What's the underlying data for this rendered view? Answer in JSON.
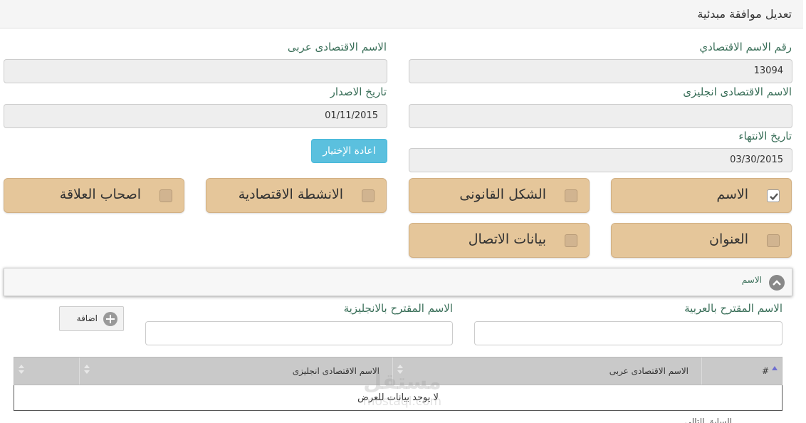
{
  "page": {
    "title": "تعديل موافقة مبدئية"
  },
  "fields": {
    "eco_name_number": {
      "label": "رقم الاسم الاقتصادي",
      "value": "13094"
    },
    "eco_name_arabic": {
      "label": "الاسم الاقتصادى عربى",
      "value": ""
    },
    "eco_name_english": {
      "label": "الاسم الاقتصادى انجليزى",
      "value": ""
    },
    "issue_date": {
      "label": "تاريخ الاصدار",
      "value": "01/11/2015"
    },
    "expiry_date": {
      "label": "تاريخ الانتهاء",
      "value": "03/30/2015"
    }
  },
  "reset_button": {
    "label": "اعادة الإختيار"
  },
  "options": [
    {
      "label": "الاسم",
      "checked": true
    },
    {
      "label": "الشكل القانونى",
      "checked": false
    },
    {
      "label": "الانشطة الاقتصادية",
      "checked": false
    },
    {
      "label": "اصحاب العلاقة",
      "checked": false
    },
    {
      "label": "العنوان",
      "checked": false
    },
    {
      "label": "بيانات الاتصال",
      "checked": false
    }
  ],
  "panel": {
    "title": "الاسم",
    "proposed_arabic_label": "الاسم المقترح بالعربية",
    "proposed_english_label": "الاسم المقترح بالانجليزية",
    "add_label": "اضافة"
  },
  "table": {
    "columns": [
      "#",
      "الاسم الاقتصادى عربى",
      "الاسم الاقتصادى انجليزى",
      ""
    ],
    "empty_message": "لا يوجد بيانات للعرض"
  },
  "watermark": {
    "arabic": "مستقل",
    "english": "mostaql.com"
  },
  "footer": {
    "text": "السابق التالى"
  },
  "colors": {
    "tile": "#e5c69a",
    "label": "#3a6f59",
    "info_button": "#5bc0de",
    "table_header": "#c9c9c9"
  }
}
